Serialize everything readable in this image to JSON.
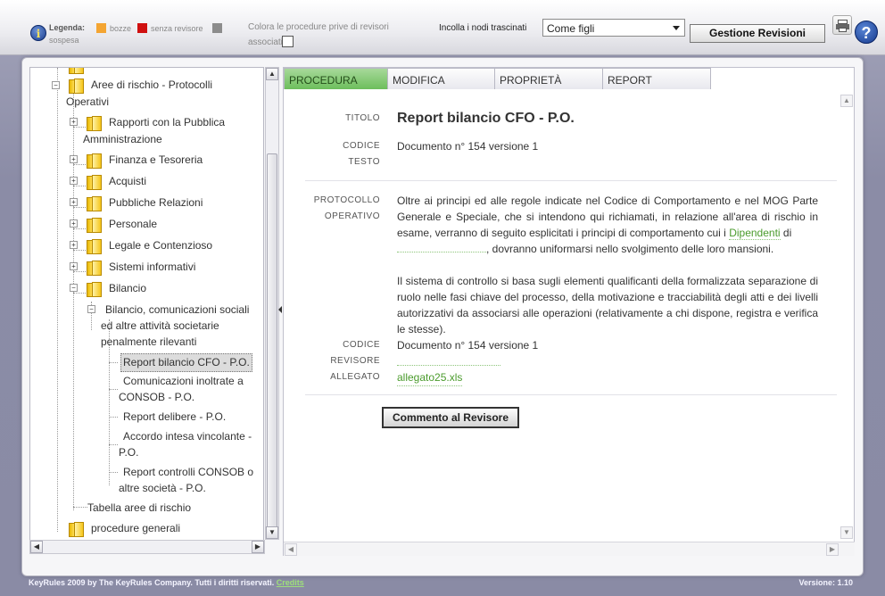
{
  "topbar": {
    "legend_title": "Legenda:",
    "legend_bozze": "bozze",
    "legend_senza_revisore": "senza revisore",
    "legend_sospesa": "sospesa",
    "colors": {
      "bozze": "#f4a532",
      "senza_revisore": "#d01010",
      "sospesa": "#8c8c8c"
    },
    "colora_label": "Colora le procedure prive di revisori associati",
    "colora_checked": false,
    "incolla_label": "Incolla i nodi trascinati",
    "incolla_selected": "Come figli",
    "gestione_button": "Gestione Revisioni",
    "icons": {
      "info": "info-icon",
      "print": "print-icon",
      "help": "help-icon"
    },
    "info_glyph": "i",
    "help_glyph": "?"
  },
  "tree": {
    "aree_rischio": "Aree di rischio - Protocolli",
    "aree_rischio_2": "Operativi",
    "rapporti": "Rapporti con la Pubblica",
    "rapporti_2": "Amministrazione",
    "finanza": "Finanza e Tesoreria",
    "acquisti": "Acquisti",
    "pubbliche": "Pubbliche Relazioni",
    "personale": "Personale",
    "legale": "Legale e Contenzioso",
    "sistemi": "Sistemi informativi",
    "bilancio": "Bilancio",
    "bilancio_com": "Bilancio, comunicazioni sociali",
    "bilancio_com_2": "ed altre attività societarie",
    "bilancio_com_3": "penalmente rilevanti",
    "report_bilancio": "Report bilancio CFO - P.O.",
    "comunicazioni": "Comunicazioni inoltrate a",
    "comunicazioni_2": "CONSOB - P.O.",
    "report_delibere": "Report delibere - P.O.",
    "accordo": "Accordo intesa vincolante -",
    "accordo_2": "P.O.",
    "report_controlli": "Report controlli CONSOB o",
    "report_controlli_2": "altre società - P.O.",
    "tabella": "Tabella aree di rischio",
    "procedure_generali": "procedure generali"
  },
  "tabs": [
    "PROCEDURA",
    "MODIFICA",
    "PROPRIETÀ",
    "REPORT"
  ],
  "active_tab": "PROCEDURA",
  "procedura": {
    "titolo_label": "TITOLO",
    "titolo_value": "Report bilancio CFO - P.O.",
    "codice_testo_label_1": "CODICE",
    "codice_testo_label_2": "TESTO",
    "codice_testo_value": "Documento n° 154 versione  1",
    "protocollo_label_1": "PROTOCOLLO",
    "protocollo_label_2": "OPERATIVO",
    "protocollo_p1_a": "Oltre ai principi ed alle regole indicate nel Codice di Comportamento e nel MOG Parte Generale e Speciale, che si intendono qui richiamati, in relazione all'area di rischio in esame, verranno di seguito esplicitati i principi di comportamento cui i ",
    "protocollo_p1_link": "Dipendenti",
    "protocollo_p1_b": " di",
    "protocollo_p1_c": ", dovranno uniformarsi nello svolgimento delle loro mansioni.",
    "protocollo_p2": "Il sistema di controllo si basa sugli elementi qualificanti della formalizzata separazione di ruolo nelle fasi chiave del processo, della motivazione e tracciabilità degli atti e dei livelli autorizzativi da associarsi alle operazioni (relativamente a chi dispone, registra e verifica le stesse).",
    "codice_rev_label_1": "CODICE",
    "codice_rev_label_2": "REVISORE",
    "codice_rev_value": "Documento n° 154 versione 1",
    "allegato_label": "ALLEGATO",
    "allegato_value": "allegato25.xls",
    "commento_button": "Commento al Revisore"
  },
  "footer": {
    "left": "KeyRules 2009 by The KeyRules Company. Tutti i diritti riservati.",
    "credits": "Credits",
    "right": "Versione: 1.10"
  }
}
